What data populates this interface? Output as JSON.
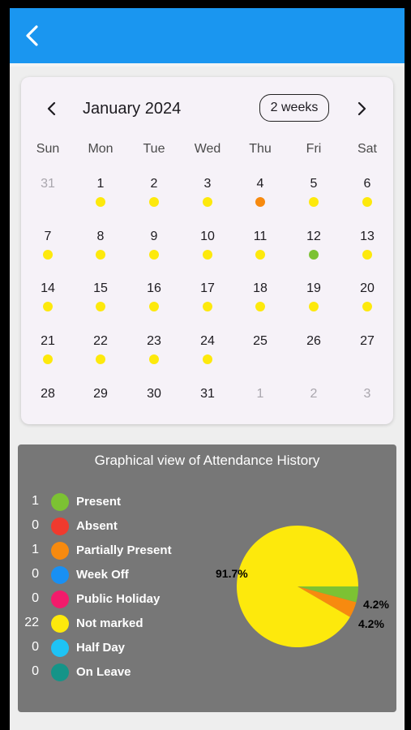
{
  "app_bar": {
    "back_icon": "chevron-left-icon",
    "color": "#1a96f0"
  },
  "calendar": {
    "title": "January 2024",
    "format_button": "2 weeks",
    "weekdays": [
      "Sun",
      "Mon",
      "Tue",
      "Wed",
      "Thu",
      "Fri",
      "Sat"
    ],
    "weeks": [
      [
        {
          "d": "31",
          "out": true
        },
        {
          "d": "1",
          "m": "not_marked"
        },
        {
          "d": "2",
          "m": "not_marked"
        },
        {
          "d": "3",
          "m": "not_marked"
        },
        {
          "d": "4",
          "m": "partially_present"
        },
        {
          "d": "5",
          "m": "not_marked"
        },
        {
          "d": "6",
          "m": "not_marked"
        }
      ],
      [
        {
          "d": "7",
          "m": "not_marked"
        },
        {
          "d": "8",
          "m": "not_marked"
        },
        {
          "d": "9",
          "m": "not_marked"
        },
        {
          "d": "10",
          "m": "not_marked"
        },
        {
          "d": "11",
          "m": "not_marked"
        },
        {
          "d": "12",
          "m": "present"
        },
        {
          "d": "13",
          "m": "not_marked"
        }
      ],
      [
        {
          "d": "14",
          "m": "not_marked"
        },
        {
          "d": "15",
          "m": "not_marked"
        },
        {
          "d": "16",
          "m": "not_marked"
        },
        {
          "d": "17",
          "m": "not_marked"
        },
        {
          "d": "18",
          "m": "not_marked"
        },
        {
          "d": "19",
          "m": "not_marked"
        },
        {
          "d": "20",
          "m": "not_marked"
        }
      ],
      [
        {
          "d": "21",
          "m": "not_marked"
        },
        {
          "d": "22",
          "m": "not_marked"
        },
        {
          "d": "23",
          "m": "not_marked"
        },
        {
          "d": "24",
          "m": "not_marked"
        },
        {
          "d": "25"
        },
        {
          "d": "26"
        },
        {
          "d": "27"
        }
      ],
      [
        {
          "d": "28"
        },
        {
          "d": "29"
        },
        {
          "d": "30"
        },
        {
          "d": "31"
        },
        {
          "d": "1",
          "out": true
        },
        {
          "d": "2",
          "out": true
        },
        {
          "d": "3",
          "out": true
        }
      ]
    ]
  },
  "status_colors": {
    "present": "#7cc233",
    "absent": "#f03a2e",
    "partially_present": "#f78a0f",
    "week_off": "#1990f3",
    "public_holiday": "#f21b6b",
    "not_marked": "#fde90c",
    "half_day": "#1ec3f5",
    "on_leave": "#159488"
  },
  "attendance": {
    "title": "Graphical view of Attendance History",
    "legend": [
      {
        "key": "present",
        "count": "1",
        "label": "Present"
      },
      {
        "key": "absent",
        "count": "0",
        "label": "Absent"
      },
      {
        "key": "partially_present",
        "count": "1",
        "label": "Partially Present"
      },
      {
        "key": "week_off",
        "count": "0",
        "label": "Week Off"
      },
      {
        "key": "public_holiday",
        "count": "0",
        "label": "Public Holiday"
      },
      {
        "key": "not_marked",
        "count": "22",
        "label": "Not marked"
      },
      {
        "key": "half_day",
        "count": "0",
        "label": "Half Day"
      },
      {
        "key": "on_leave",
        "count": "0",
        "label": "On Leave"
      }
    ]
  },
  "chart_data": {
    "type": "pie",
    "categories": [
      "Present",
      "Partially Present",
      "Not marked"
    ],
    "values": [
      4.2,
      4.2,
      91.7
    ],
    "data_labels": [
      "4.2%",
      "4.2%",
      "91.7%"
    ],
    "colors": [
      "#7cc233",
      "#f78a0f",
      "#fde90c"
    ]
  }
}
